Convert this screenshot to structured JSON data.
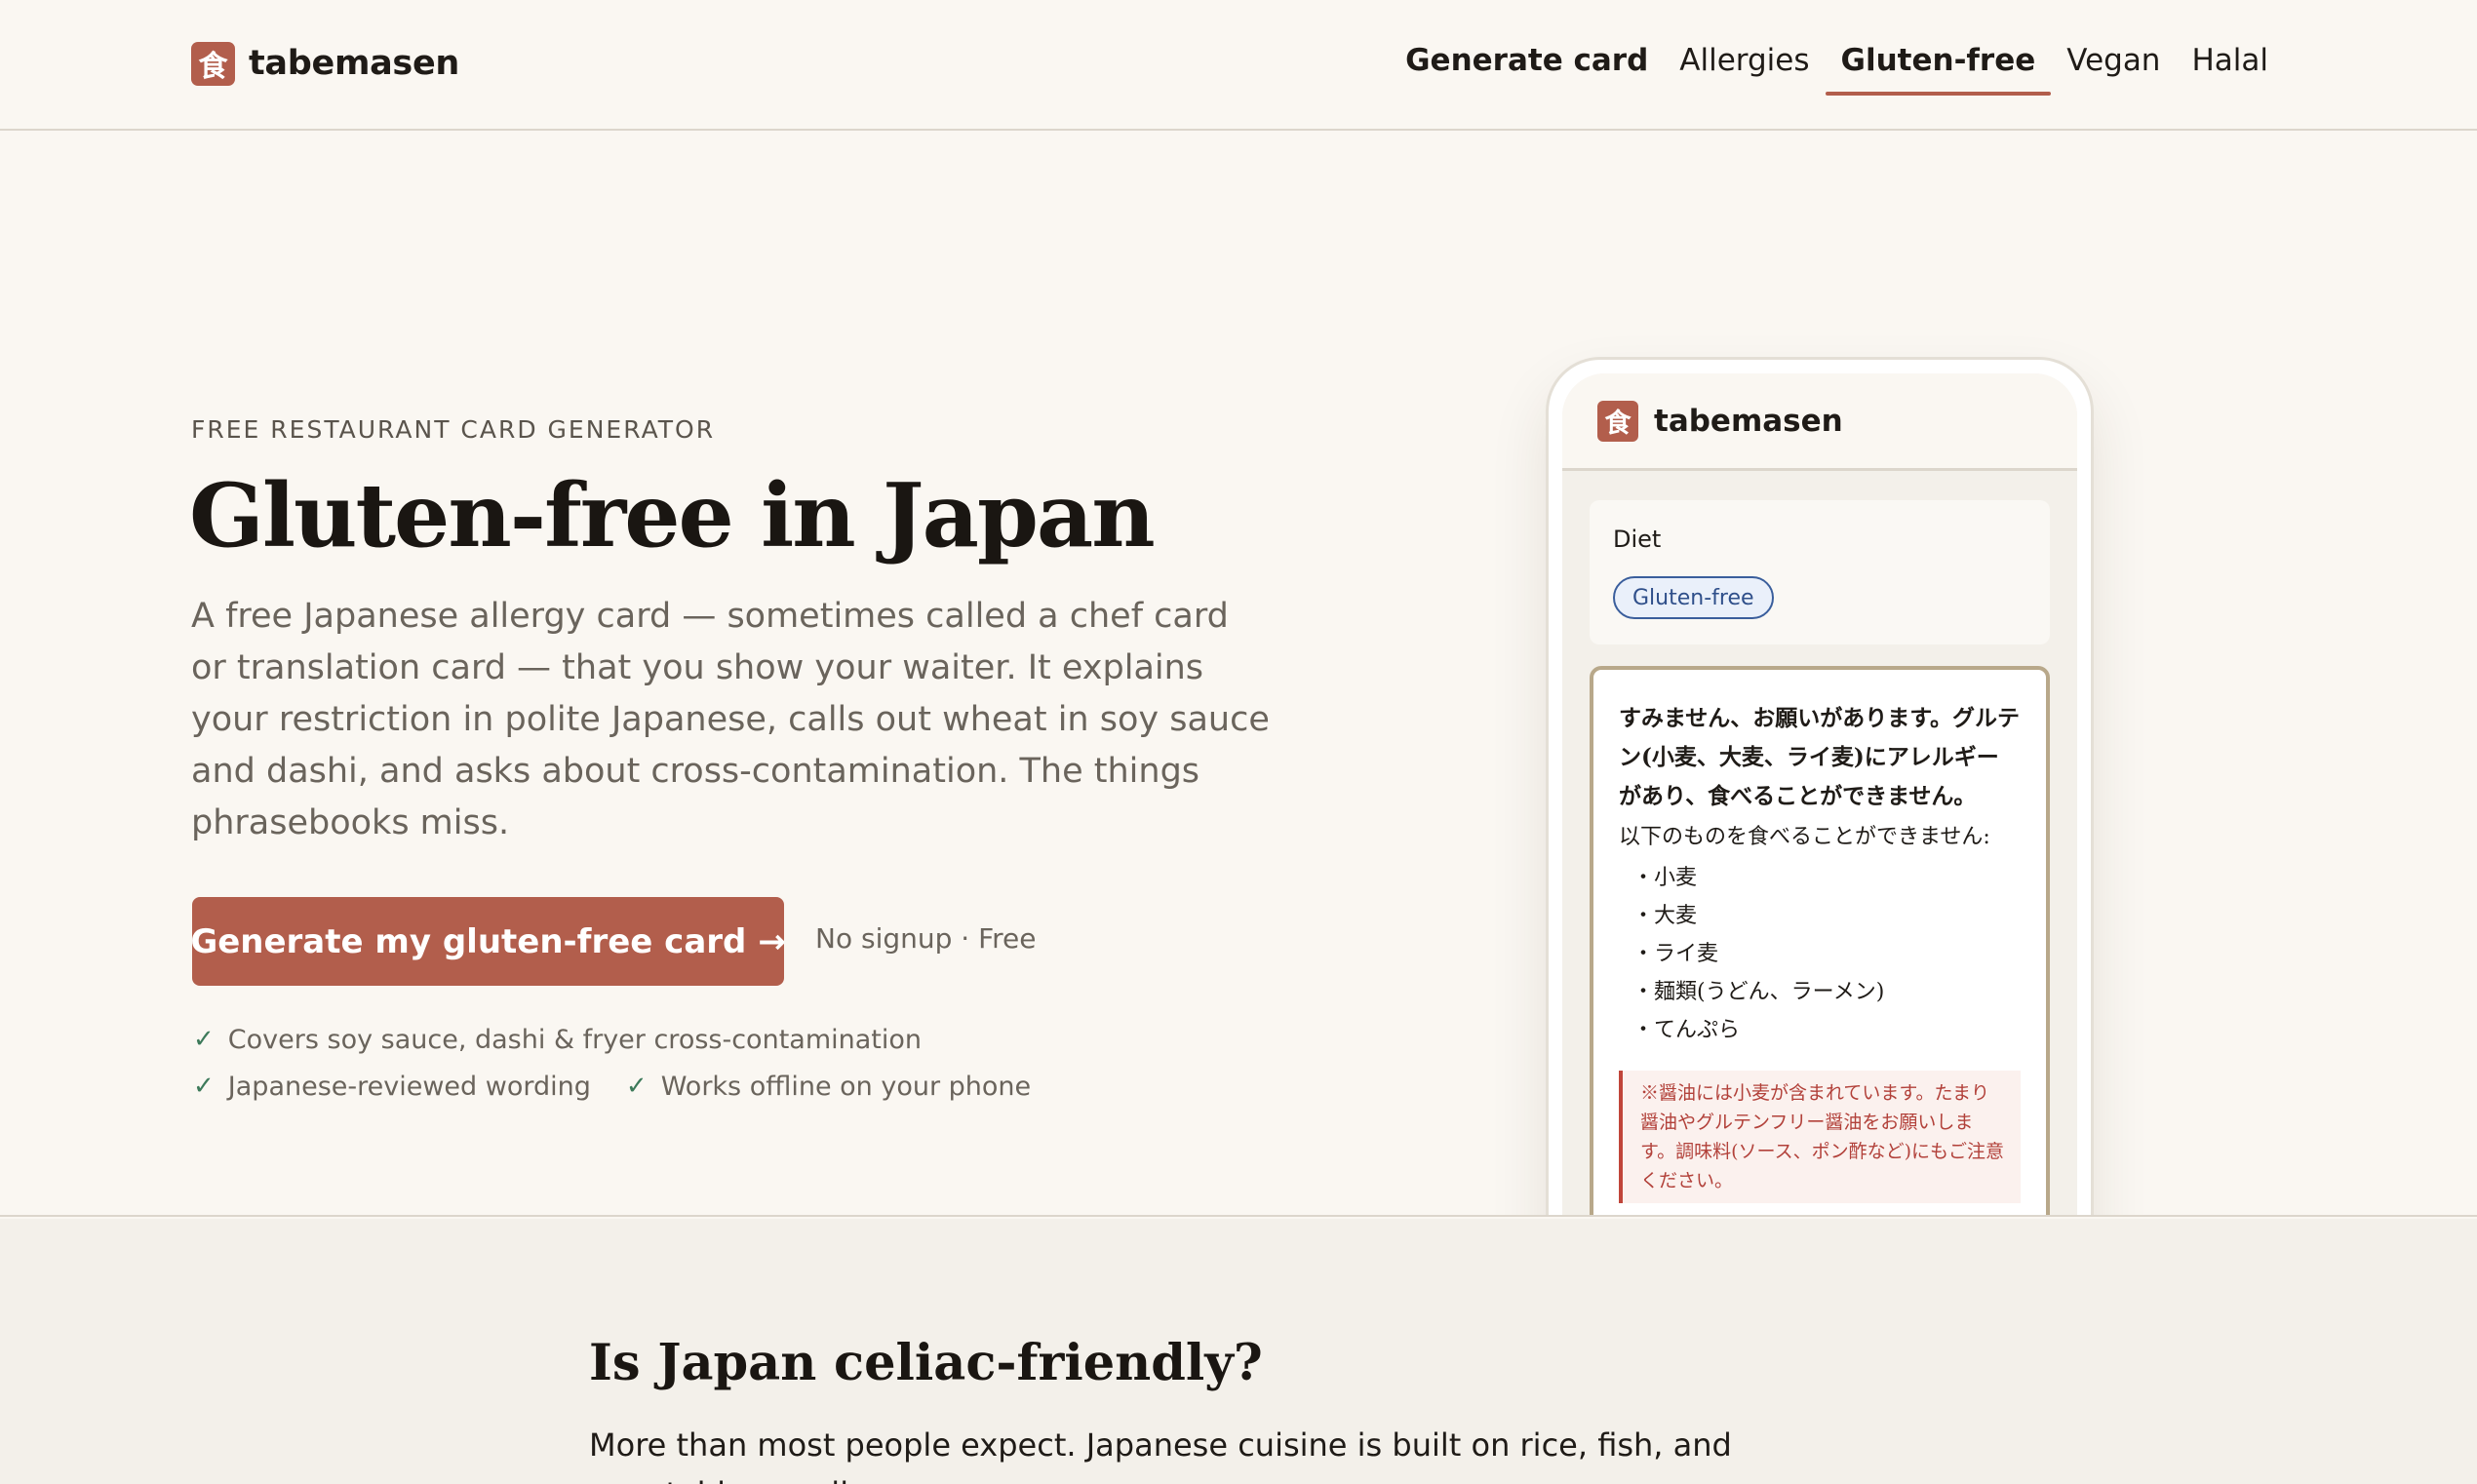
{
  "header": {
    "logo_glyph": "食",
    "brand": "tabemasen",
    "nav": [
      {
        "label": "Generate card",
        "active": false
      },
      {
        "label": "Allergies",
        "active": false
      },
      {
        "label": "Gluten-free",
        "active": true
      },
      {
        "label": "Vegan",
        "active": false
      },
      {
        "label": "Halal",
        "active": false
      }
    ]
  },
  "hero": {
    "eyebrow": "FREE RESTAURANT CARD GENERATOR",
    "title": "Gluten-free in Japan",
    "lede": "A free Japanese allergy card — sometimes called a chef card or translation card — that you show your waiter. It explains your restriction in polite Japanese, calls out wheat in soy sauce and dashi, and asks about cross-contamination. The things phrasebooks miss.",
    "cta_label": "Generate my gluten-free card →",
    "cta_note": "No signup · Free",
    "checks": [
      "Covers soy sauce, dashi & fryer cross-contamination",
      "Japanese-reviewed wording",
      "Works offline on your phone"
    ],
    "check_glyph": "✓"
  },
  "phone": {
    "logo_glyph": "食",
    "brand": "tabemasen",
    "diet_label": "Diet",
    "diet_chip": "Gluten-free",
    "card_lead": "すみません、お願いがあります。グルテン(小麦、大麦、ライ麦)にアレルギーがあり、食べることができません。",
    "card_sub": "以下のものを食べることができません:",
    "card_items": [
      "・小麦",
      "・大麦",
      "・ライ麦",
      "・麺類(うどん、ラーメン)",
      "・てんぷら"
    ],
    "card_note": "※醤油には小麦が含まれています。たまり醤油やグルテンフリー醤油をお願いします。調味料(ソース、ポン酢など)にもご注意ください。"
  },
  "section": {
    "title": "Is Japan celiac-friendly?",
    "text": "More than most people expect. Japanese cuisine is built on rice, fish, and vegetables — all"
  },
  "colors": {
    "accent": "#b25e4c",
    "background": "#faf7f2",
    "chip_blue": "#3a5e9c",
    "warning_red": "#c0453a"
  }
}
